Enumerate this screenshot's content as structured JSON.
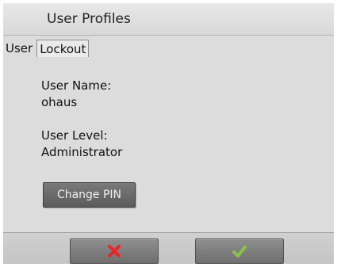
{
  "header": {
    "title": "User Profiles"
  },
  "tabs": [
    {
      "label": "User",
      "active": true
    },
    {
      "label": "Lockout",
      "active": false
    }
  ],
  "profile": {
    "user_name_label": "User Name:",
    "user_name_value": "ohaus",
    "user_level_label": "User Level:",
    "user_level_value": "Administrator"
  },
  "actions": {
    "change_pin_label": "Change PIN",
    "cancel_icon": "x-icon",
    "confirm_icon": "check-icon"
  },
  "colors": {
    "cancel_icon": "#e8262a",
    "confirm_icon": "#8bc34a",
    "button_gray": "#6a6a6a",
    "background": "#dcdcdc"
  }
}
